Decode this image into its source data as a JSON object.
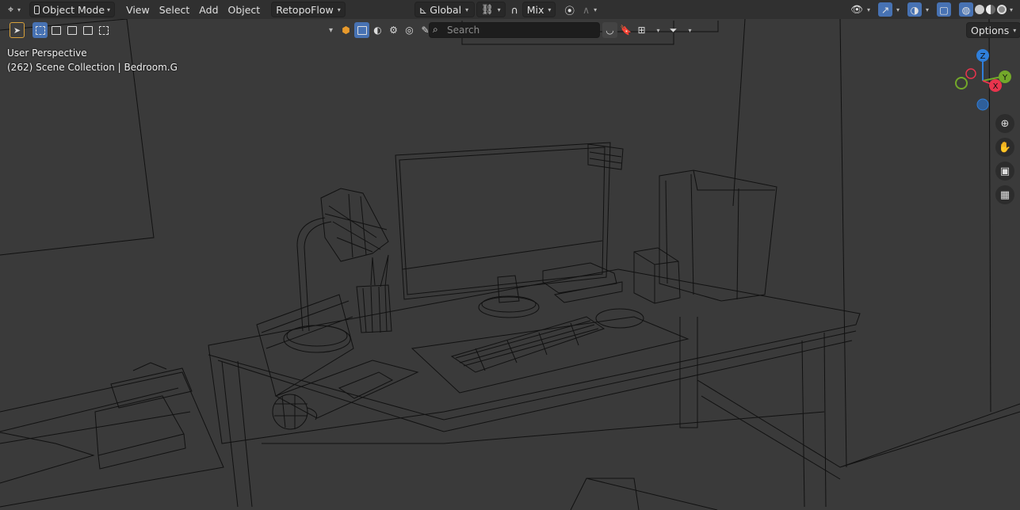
{
  "header": {
    "editor_icon": "axes-cursor-icon",
    "mode": "Object Mode",
    "menus": [
      "View",
      "Select",
      "Add",
      "Object"
    ],
    "addon_menu": "RetopoFlow",
    "transform_orientation": "Global",
    "snap_mode": "Mix"
  },
  "tool_header": {
    "search_placeholder": "Search",
    "options_label": "Options"
  },
  "viewport": {
    "view_name": "User Perspective",
    "collection_info": "(262) Scene Collection | Bedroom.G"
  },
  "gizmo": {
    "z_label": "Z",
    "y_label": "Y",
    "x_label": "X",
    "colors": {
      "x": "#e8344d",
      "y": "#73a82a",
      "z": "#2f7fdb"
    }
  },
  "colors": {
    "accent": "#4772b3",
    "header": "#303030",
    "viewport": "#3a3a3a",
    "wire": "#111111"
  }
}
